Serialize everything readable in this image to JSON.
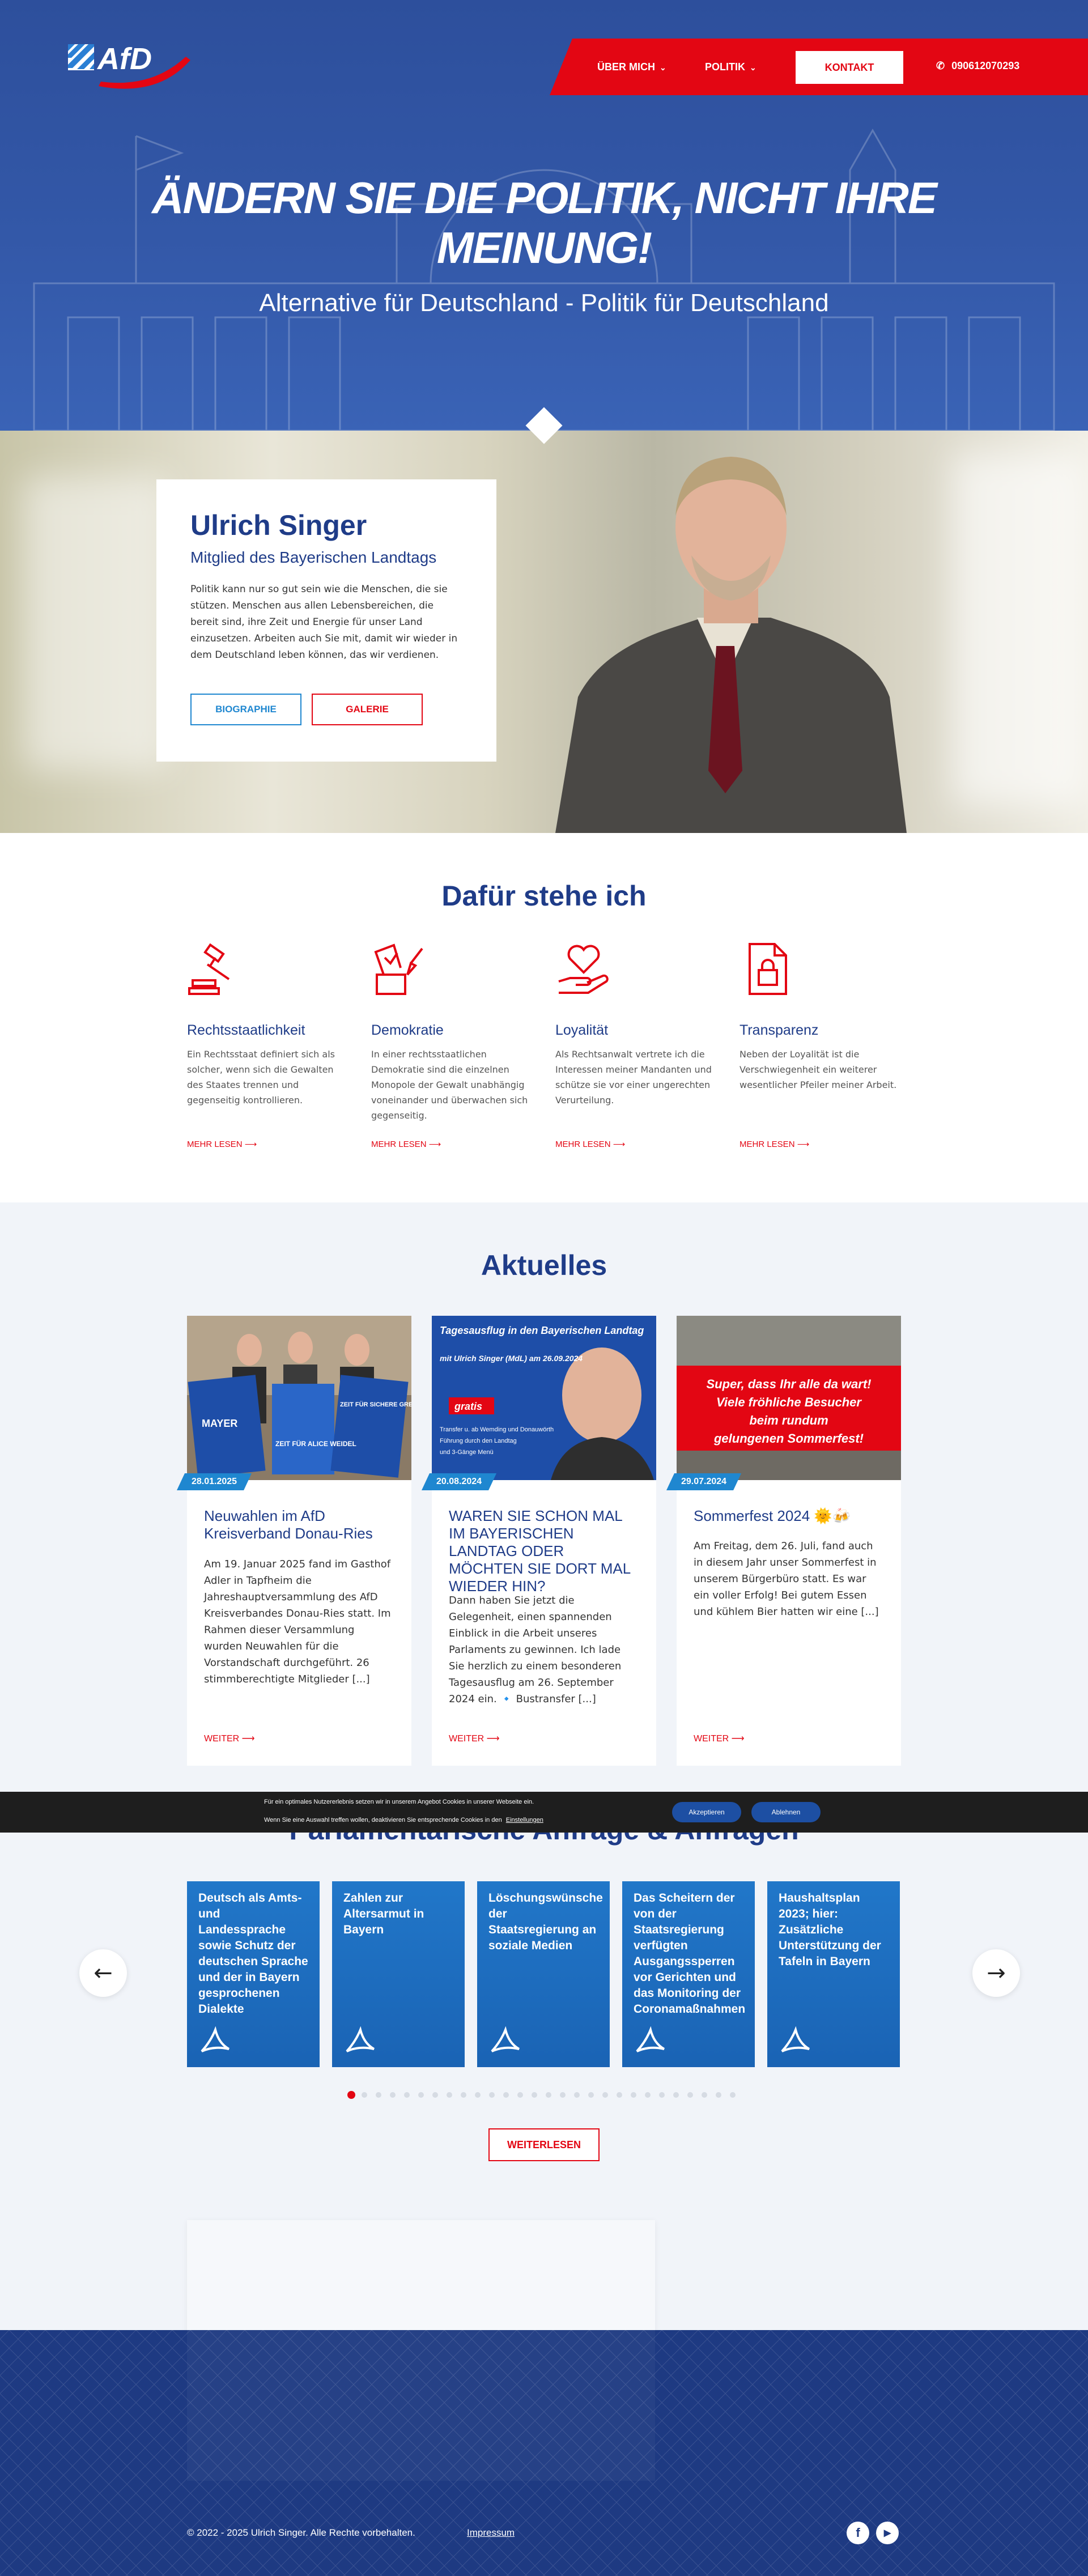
{
  "header": {
    "logo_text": "AfD",
    "nav": [
      {
        "label": "ÜBER MICH"
      },
      {
        "label": "POLITIK"
      }
    ],
    "contact_label": "KONTAKT",
    "phone": "090612070293"
  },
  "hero": {
    "title": "ÄNDERN SIE DIE POLITIK, NICHT IHRE MEINUNG!",
    "subtitle": "Alternative für Deutschland - Politik für Deutschland"
  },
  "profile": {
    "name": "Ulrich Singer",
    "role": "Mitglied des Bayerischen Landtags",
    "text": "Politik kann nur so gut sein wie die Menschen, die sie stützen. Menschen aus allen Lebensbereichen, die bereit sind, ihre Zeit und Energie für unser Land einzusetzen. Arbeiten auch Sie mit, damit wir wieder in dem Deutschland leben können, das wir verdienen.",
    "btn_bio": "BIOGRAPHIE",
    "btn_gallery": "GALERIE"
  },
  "values": {
    "title": "Dafür stehe ich",
    "items": [
      {
        "title": "Rechtsstaatlichkeit",
        "text": "Ein Rechtsstaat definiert sich als solcher, wenn sich die Gewalten des Staates trennen und gegenseitig kontrollieren.",
        "more": "MEHR LESEN",
        "icon": "gavel-icon"
      },
      {
        "title": "Demokratie",
        "text": "In einer rechtsstaatlichen Demokratie sind die einzelnen Monopole der Gewalt unabhängig voneinander und überwachen sich gegenseitig.",
        "more": "MEHR LESEN",
        "icon": "ballot-icon"
      },
      {
        "title": "Loyalität",
        "text": "Als Rechtsanwalt vertrete ich die Interessen meiner Mandanten und schütze sie vor einer ungerechten Verurteilung.",
        "more": "MEHR LESEN",
        "icon": "heart-hand-icon"
      },
      {
        "title": "Transparenz",
        "text": "Neben der Loyalität ist die Verschwiegenheit ein weiterer wesentlicher Pfeiler meiner Arbeit.",
        "more": "MEHR LESEN",
        "icon": "lock-document-icon"
      }
    ]
  },
  "news": {
    "title": "Aktuelles",
    "items": [
      {
        "date": "28.01.2025",
        "title": "Neuwahlen im AfD Kreisverband Donau-Ries",
        "text": "Am 19. Januar 2025 fand im Gasthof Adler in Tapfheim die Jahreshauptversammlung des AfD Kreisverbandes Donau-Ries statt. Im Rahmen dieser Versammlung wurden Neuwahlen für die Vorstandschaft durchgeführt. 26 stimmberechtigte Mitglieder [...]",
        "more": "WEITER",
        "img_texts": [
          "MAYER",
          "ZEIT FÜR ALICE WEIDEL",
          "ZEIT FÜR SICHERE GRENZEN."
        ]
      },
      {
        "date": "20.08.2024",
        "title": "WAREN SIE SCHON MAL IM BAYERISCHEN LANDTAG ODER MÖCHTEN SIE DORT MAL WIEDER HIN?",
        "text": "Dann haben Sie jetzt die Gelegenheit, einen spannenden Einblick in die Arbeit unseres Parlaments zu gewinnen. Ich lade Sie herzlich zu einem besonderen Tagesausflug am 26. September 2024 ein. 🔹 Bustransfer [...]",
        "more": "WEITER",
        "img_texts": [
          "Tagesausflug in den Bayerischen Landtag",
          "mit Ulrich Singer (MdL) am 26.09.2024",
          "gratis",
          "Transfer u. ab Wemding und Donauwörth",
          "Führung durch den Landtag",
          "und 3-Gänge Menü"
        ]
      },
      {
        "date": "29.07.2024",
        "title": "Sommerfest 2024 🌞🍻",
        "text": "Am Freitag, dem 26. Juli, fand auch in diesem Jahr unser Sommerfest in unserem Bürgerbüro statt. Es war ein voller Erfolg! Bei gutem Essen und kühlem Bier hatten wir eine [...]",
        "more": "WEITER",
        "img_texts": [
          "Super, dass Ihr alle da wart!",
          "Viele fröhliche Besucher",
          "beim rundum",
          "gelungenen Sommerfest!"
        ]
      }
    ]
  },
  "parliament": {
    "title": "Parlamentarische Anfrage & Anfragen",
    "items": [
      {
        "title": "Deutsch als Amts- und Landessprache sowie Schutz der deutschen Sprache und der in Bayern gesprochenen Dialekte"
      },
      {
        "title": "Zahlen zur Altersarmut in Bayern"
      },
      {
        "title": "Löschungswünsche der Staatsregierung an soziale Medien"
      },
      {
        "title": "Das Scheitern der von der Staatsregierung verfügten Ausgangssperren vor Gerichten und das Monitoring der Coronamaßnahmen"
      },
      {
        "title": "Haushaltsplan 2023; hier: Zusätzliche Unterstützung der Tafeln in Bayern"
      }
    ],
    "dots_total": 28,
    "active_dot": 1,
    "more_label": "WEITERLESEN"
  },
  "cookie": {
    "line1": "Für ein optimales Nutzererlebnis setzen wir in unserem Angebot Cookies in unserer Webseite ein.",
    "line2": "Wenn Sie eine Auswahl treffen wollen, deaktivieren Sie entsprechende Cookies in den",
    "link": "Einstellungen",
    "accept": "Akzeptieren",
    "reject": "Ablehnen"
  },
  "footer": {
    "copyright": "© 2022 - 2025 Ulrich Singer. Alle Rechte vorbehalten.",
    "impressum": "Impressum"
  },
  "colors": {
    "brand_blue": "#1f3c88",
    "accent_red": "#e30613",
    "link_blue": "#1f87d0"
  }
}
